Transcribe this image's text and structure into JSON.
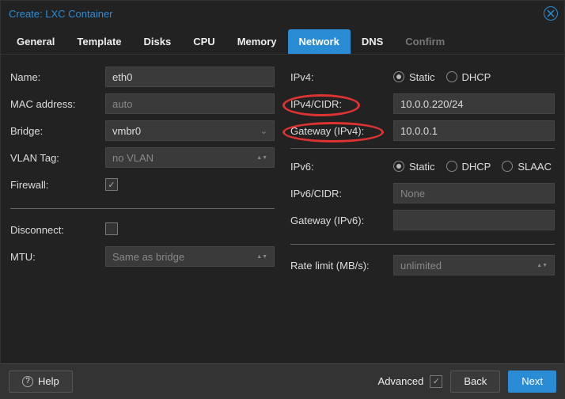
{
  "window": {
    "title": "Create: LXC Container"
  },
  "tabs": [
    "General",
    "Template",
    "Disks",
    "CPU",
    "Memory",
    "Network",
    "DNS",
    "Confirm"
  ],
  "tabs_active_index": 5,
  "tabs_disabled_index": 7,
  "left": {
    "name_label": "Name:",
    "name_value": "eth0",
    "mac_label": "MAC address:",
    "mac_placeholder": "auto",
    "bridge_label": "Bridge:",
    "bridge_value": "vmbr0",
    "vlan_label": "VLAN Tag:",
    "vlan_placeholder": "no VLAN",
    "firewall_label": "Firewall:",
    "firewall_checked": true,
    "disconnect_label": "Disconnect:",
    "disconnect_checked": false,
    "mtu_label": "MTU:",
    "mtu_placeholder": "Same as bridge"
  },
  "right": {
    "ipv4_label": "IPv4:",
    "ipv4_mode": "Static",
    "ipv4_options": [
      "Static",
      "DHCP"
    ],
    "ipv4cidr_label": "IPv4/CIDR:",
    "ipv4cidr_value": "10.0.0.220/24",
    "gw4_label": "Gateway (IPv4):",
    "gw4_value": "10.0.0.1",
    "ipv6_label": "IPv6:",
    "ipv6_mode": "Static",
    "ipv6_options": [
      "Static",
      "DHCP",
      "SLAAC"
    ],
    "ipv6cidr_label": "IPv6/CIDR:",
    "ipv6cidr_placeholder": "None",
    "gw6_label": "Gateway (IPv6):",
    "rate_label": "Rate limit (MB/s):",
    "rate_placeholder": "unlimited"
  },
  "footer": {
    "help": "Help",
    "advanced": "Advanced",
    "advanced_checked": true,
    "back": "Back",
    "next": "Next"
  }
}
